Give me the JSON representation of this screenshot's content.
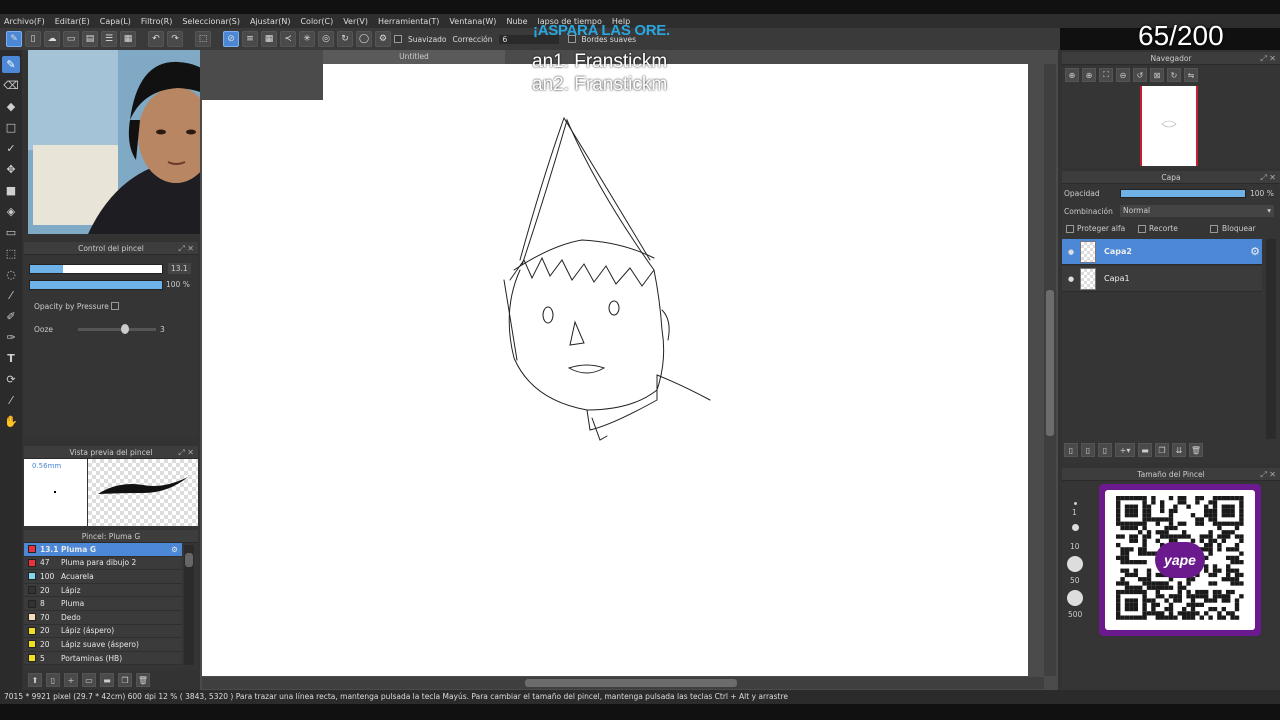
{
  "menu": [
    "Archivo(F)",
    "Editar(E)",
    "Capa(L)",
    "Filtro(R)",
    "Seleccionar(S)",
    "Ajustar(N)",
    "Color(C)",
    "Ver(V)",
    "Herramienta(T)",
    "Ventana(W)",
    "Nube",
    "lapso de tiempo",
    "Help"
  ],
  "toolbar": {
    "smoothing_label": "Suavizado",
    "correction_label": "Corrección",
    "correction_value": "6",
    "soft_edges_label": "Bordes suaves"
  },
  "document_tab": "Untitled",
  "overlay": {
    "title": "¡ASPARA LAS ORE.",
    "line1": "an1. Franstickm",
    "line2": "an2. Franstickm",
    "counter": "65/200"
  },
  "brush_control": {
    "title": "Control del pincel",
    "size_value": "13.1",
    "size_fill": 0.25,
    "opacity_value": "100 %",
    "opacity_fill": 1.0,
    "opacity_pressure_label": "Opacity by Pressure",
    "ooze_label": "Ooze",
    "ooze_value": "3",
    "ooze_fill": 0.6
  },
  "brush_preview": {
    "title": "Vista previa del pincel",
    "size_label": "0.56mm"
  },
  "brush_list": {
    "title": "Pincel: Pluma G",
    "items": [
      {
        "size": "13.1",
        "name": "Pluma G",
        "color": "#e8323c",
        "selected": true
      },
      {
        "size": "47",
        "name": "Pluma para dibujo 2",
        "color": "#e8323c",
        "selected": false
      },
      {
        "size": "100",
        "name": "Acuarela",
        "color": "#7fd8f0",
        "selected": false
      },
      {
        "size": "20",
        "name": "Lápiz",
        "color": "#333333",
        "selected": false
      },
      {
        "size": "8",
        "name": "Pluma",
        "color": "#333333",
        "selected": false
      },
      {
        "size": "70",
        "name": "Dedo",
        "color": "#f4dcb8",
        "selected": false
      },
      {
        "size": "20",
        "name": "Lápiz (áspero)",
        "color": "#f0e020",
        "selected": false
      },
      {
        "size": "20",
        "name": "Lápiz suave (áspero)",
        "color": "#f0e020",
        "selected": false
      },
      {
        "size": "5",
        "name": "Portaminas (HB)",
        "color": "#f0e020",
        "selected": false
      }
    ]
  },
  "navigator": {
    "title": "Navegador"
  },
  "layer_panel": {
    "title": "Capa",
    "opacity_label": "Opacidad",
    "opacity_value": "100 %",
    "opacity_fill": 1.0,
    "blend_label": "Combinación",
    "blend_value": "Normal",
    "protect_alpha": "Proteger alfa",
    "clipping": "Recorte",
    "lock": "Bloquear",
    "layers": [
      {
        "name": "Capa2",
        "selected": true
      },
      {
        "name": "Capa1",
        "selected": false
      }
    ]
  },
  "brush_size_panel": {
    "title": "Tamaño del Pincel",
    "sizes": [
      "1",
      "10",
      "50",
      "500"
    ],
    "qr_label": "yape"
  },
  "status": {
    "text": "7015 * 9921 pixel  (29.7 * 42cm)  600 dpi  12 %  ( 3843, 5320 )  Para trazar una línea recta, mantenga pulsada la tecla Mayús. Para cambiar el tamaño del pincel, mantenga pulsada las teclas Ctrl + Alt y arrastre"
  },
  "colors": {
    "accent": "#4c88d6",
    "overlay_title": "#29a8e0",
    "qr_frame": "#6a1a8c"
  }
}
